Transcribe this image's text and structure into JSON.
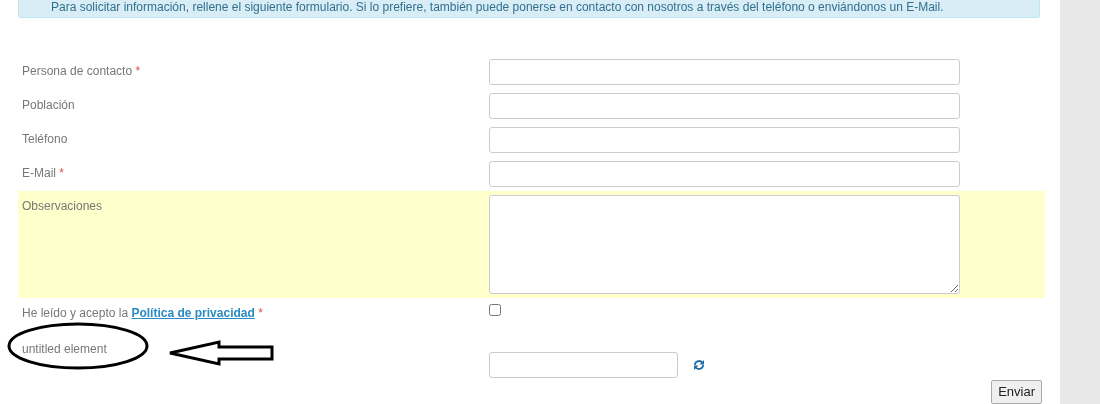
{
  "alert": {
    "text": "Para solicitar información, rellene el siguiente formulario. Si lo prefiere, también puede ponerse en contacto con nosotros  a través del teléfono o enviándonos un E-Mail."
  },
  "fields": [
    {
      "kind": "text",
      "label": "Persona de contacto",
      "required_mark": "*",
      "highlighted": false
    },
    {
      "kind": "text",
      "label": "Población",
      "highlighted": false
    },
    {
      "kind": "text",
      "label": "Teléfono",
      "highlighted": false
    },
    {
      "kind": "text",
      "label": "E-Mail",
      "required_mark": "*",
      "highlighted": false
    },
    {
      "kind": "textarea",
      "label": "Observaciones",
      "highlighted": true
    },
    {
      "kind": "checkbox",
      "label": "He leído y acepto la",
      "link": "Política de privacidad",
      "required_mark": "*",
      "checked": false,
      "highlighted": false
    },
    {
      "kind": "captcha",
      "label": "untitled element",
      "highlighted": false
    }
  ],
  "submit": "Enviar"
}
